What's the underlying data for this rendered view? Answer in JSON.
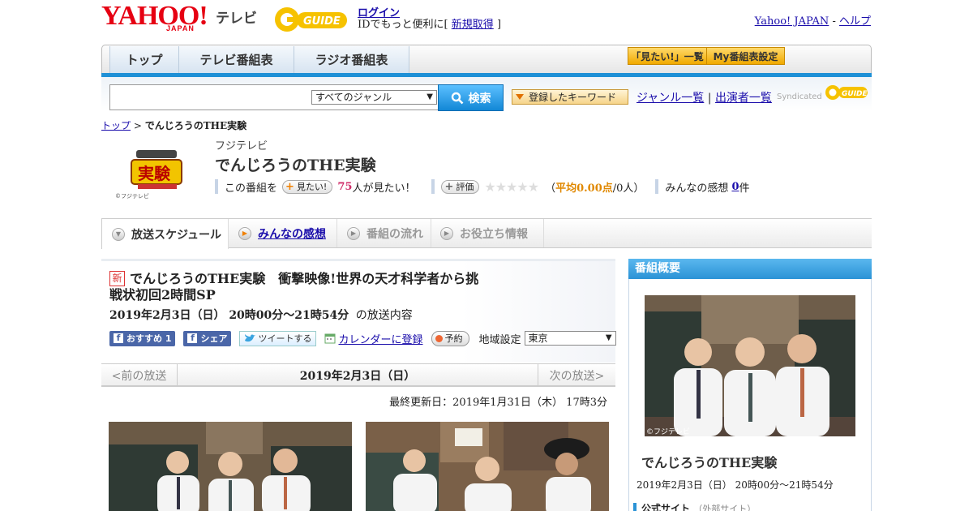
{
  "header": {
    "logo_text": "YAHOO!",
    "logo_sub": "JAPAN",
    "tv_label": "テレビ",
    "gguide_label": "G-GUIDE",
    "login_label": "ログイン",
    "login_sub_prefix": "IDでもっと便利に[",
    "signup_label": "新規取得",
    "login_sub_suffix": "]",
    "yahoo_japan_link": "Yahoo! JAPAN",
    "separator": "-",
    "help_link": "ヘルプ"
  },
  "nav": {
    "tabs": [
      {
        "label": "トップ"
      },
      {
        "label": "テレビ番組表"
      },
      {
        "label": "ラジオ番組表"
      }
    ],
    "want_list_btn": "「見たい!」一覧",
    "my_schedule_btn": "My番組表設定"
  },
  "search": {
    "placeholder": "",
    "genre_selected": "すべてのジャンル",
    "search_btn": "検索",
    "keyword_btn": "登録したキーワード",
    "genre_list_link": "ジャンル一覧",
    "link_sep": "|",
    "cast_list_link": "出演者一覧",
    "syndicated_label": "Syndicated"
  },
  "breadcrumb": {
    "top": "トップ",
    "sep": ">",
    "current": "でんじろうのTHE実験"
  },
  "program": {
    "logo_caption": "実験",
    "logo_copyright": "©フジテレビ",
    "broadcaster": "フジテレビ",
    "title": "でんじろうのTHE実験",
    "want_prefix": "この番組を",
    "want_btn": "見たい!",
    "want_count": "75",
    "want_suffix": "人が見たい！",
    "rate_btn": "評価",
    "stars": "★★★★★",
    "rating_open": "（",
    "rating_label": "平均0.00点",
    "rating_count": "/0人）",
    "impressions_label": "みんなの感想",
    "impressions_count": "0",
    "impressions_unit": "件"
  },
  "subtabs": [
    {
      "label": "放送スケジュール"
    },
    {
      "label": "みんなの感想"
    },
    {
      "label": "番組の流れ"
    },
    {
      "label": "お役立ち情報"
    }
  ],
  "episode": {
    "new_badge": "新",
    "title": "でんじろうのTHE実験　衝撃映像!世界の天才科学者から挑戦状初回2時間SP",
    "date_time": "2019年2月3日（日） 20時00分～21時54分",
    "content_suffix": "の放送内容",
    "fb_recommend": "おすすめ 1",
    "fb_share": "シェア",
    "tweet": "ツイートする",
    "calendar": "カレンダーに登録",
    "reserve": "予約",
    "region_label": "地域設定",
    "region_selected": "東京",
    "prev": "<前の放送",
    "date_center": "2019年2月3日（日）",
    "next": "次の放送>",
    "updated": "最終更新日：2019年1月31日（木） 17時3分"
  },
  "side": {
    "header": "番組概要",
    "photo_copyright": "©フジテレビ",
    "title": "でんじろうのTHE実験",
    "time": "2019年2月3日（日） 20時00分～21時54分",
    "official_site": "公式サイト",
    "official_site_note": "（外部サイト）"
  },
  "colors": {
    "accent_blue": "#1e90d6",
    "yahoo_red": "#e60012",
    "want_pink": "#d0306b",
    "rating_orange": "#e08800"
  }
}
